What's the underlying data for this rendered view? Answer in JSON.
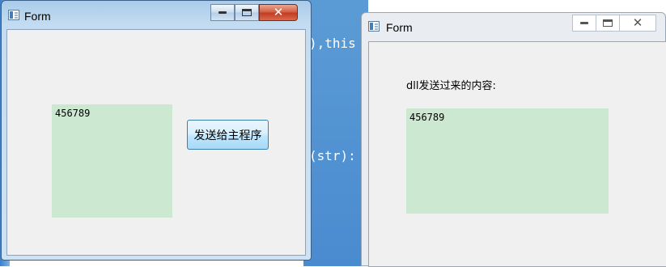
{
  "background": {
    "code_line_1": "),this",
    "code_line_2": "(str):"
  },
  "left_window": {
    "title": "Form",
    "textbox_value": "456789",
    "send_button_label": "发送给主程序",
    "minimize_icon": "minimize-icon",
    "maximize_icon": "maximize-icon",
    "close_icon": "close-icon",
    "close_glyph": "✕"
  },
  "right_window": {
    "title": "Form",
    "label": "dll发送过来的内容:",
    "textbox_value": "456789",
    "minimize_icon": "minimize-icon",
    "maximize_icon": "maximize-icon",
    "close_icon": "close-icon",
    "close_glyph": "✕"
  },
  "colors": {
    "textbox_bg": "#cde8d0",
    "close_button_active": "#c13a20",
    "editor_accent": "#4a8bd0"
  }
}
